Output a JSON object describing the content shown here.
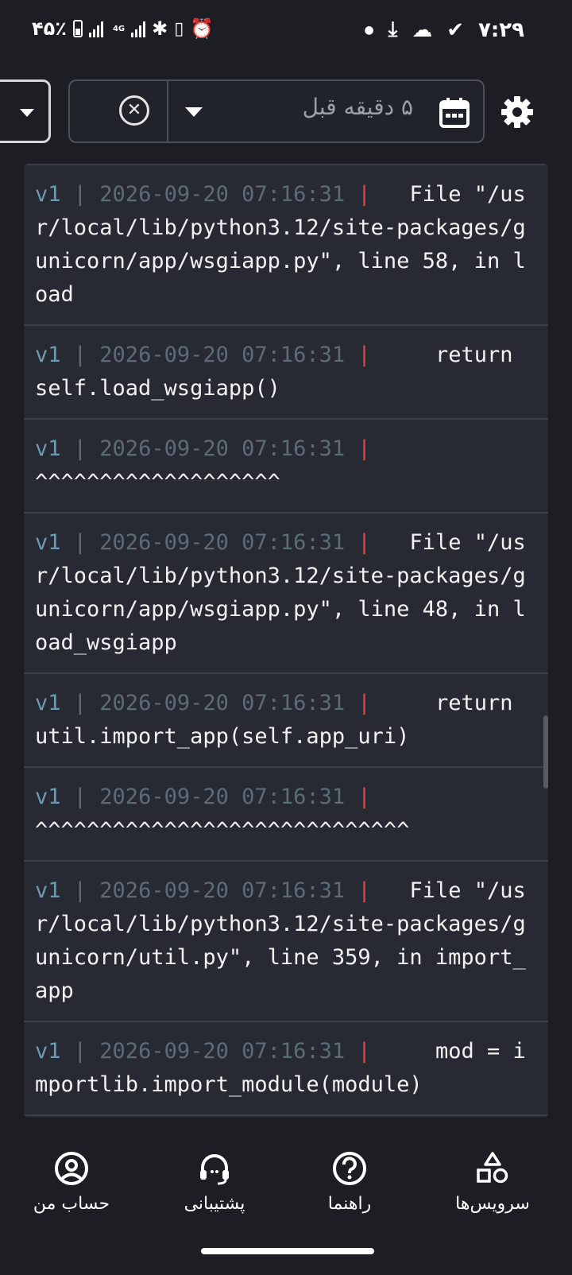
{
  "status_bar": {
    "battery_percent": "۴۵٪",
    "network": "4G",
    "time": "۷:۲۹"
  },
  "toolbar": {
    "time_filter": "۵ دقیقه قبل",
    "clear_icon": "close-circle-icon",
    "calendar_icon": "calendar-icon",
    "settings_icon": "gear-icon"
  },
  "logs": [
    {
      "service": "v1",
      "sep": " | ",
      "timestamp": "2026-09-20 07:16:31",
      "pipe": " | ",
      "message": "  File \"/usr/local/lib/python3.12/site-packages/gunicorn/app/wsgiapp.py\", line 58, in load"
    },
    {
      "service": "v1",
      "sep": " | ",
      "timestamp": "2026-09-20 07:16:31",
      "pipe": " | ",
      "message": "    return self.load_wsgiapp()"
    },
    {
      "service": "v1",
      "sep": " | ",
      "timestamp": "2026-09-20 07:16:31",
      "pipe": " | ",
      "message": "           ^^^^^^^^^^^^^^^^^^^"
    },
    {
      "service": "v1",
      "sep": " | ",
      "timestamp": "2026-09-20 07:16:31",
      "pipe": " | ",
      "message": "  File \"/usr/local/lib/python3.12/site-packages/gunicorn/app/wsgiapp.py\", line 48, in load_wsgiapp"
    },
    {
      "service": "v1",
      "sep": " | ",
      "timestamp": "2026-09-20 07:16:31",
      "pipe": " | ",
      "message": "    return util.import_app(self.app_uri)"
    },
    {
      "service": "v1",
      "sep": " | ",
      "timestamp": "2026-09-20 07:16:31",
      "pipe": " | ",
      "message": "           ^^^^^^^^^^^^^^^^^^^^^^^^^^^^^"
    },
    {
      "service": "v1",
      "sep": " | ",
      "timestamp": "2026-09-20 07:16:31",
      "pipe": " | ",
      "message": "  File \"/usr/local/lib/python3.12/site-packages/gunicorn/util.py\", line 359, in import_app"
    },
    {
      "service": "v1",
      "sep": " | ",
      "timestamp": "2026-09-20 07:16:31",
      "pipe": " | ",
      "message": "    mod = importlib.import_module(module)"
    }
  ],
  "bottom_nav": {
    "account": "حساب من",
    "support": "پشتیبانی",
    "help": "راهنما",
    "services": "سرویس‌ها"
  }
}
